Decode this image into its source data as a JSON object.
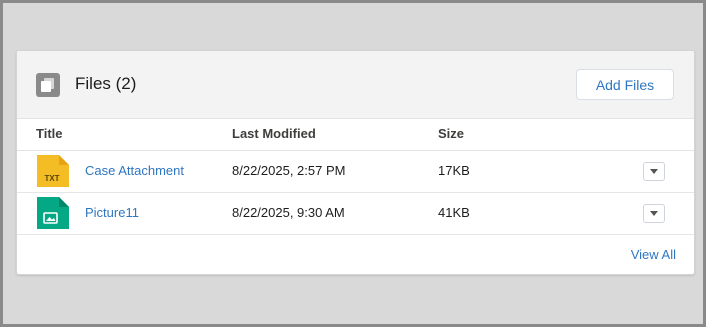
{
  "card": {
    "title": "Files (2)",
    "add_files_label": "Add Files",
    "view_all_label": "View All"
  },
  "table": {
    "columns": [
      "Title",
      "Last Modified",
      "Size"
    ],
    "rows": [
      {
        "title": "Case Attachment",
        "last_modified": "8/22/2025, 2:57 PM",
        "size": "17KB",
        "icon": "txt-file-icon",
        "icon_label": "TXT",
        "icon_color": "#f4bc25"
      },
      {
        "title": "Picture11",
        "last_modified": "8/22/2025, 9:30 AM",
        "size": "41KB",
        "icon": "image-file-icon",
        "icon_color": "#04a885"
      }
    ]
  },
  "icons": {
    "header": "files-icon",
    "row_action": "chevron-down-icon"
  },
  "colors": {
    "link": "#2f76c2",
    "frame_background": "#d9d9d9",
    "header_background": "#f3f3f3"
  }
}
